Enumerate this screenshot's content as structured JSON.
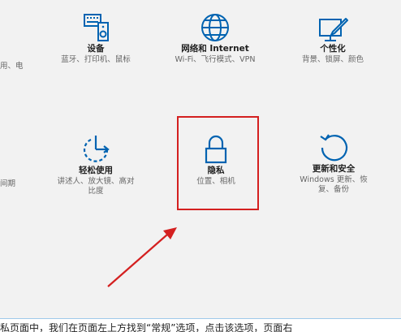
{
  "left_fragments": {
    "row1": "用、电",
    "row2": "间期"
  },
  "tiles": {
    "devices": {
      "icon": "devices-icon",
      "title": "设备",
      "desc": "蓝牙、打印机、鼠标"
    },
    "network": {
      "icon": "globe-icon",
      "title": "网络和 Internet",
      "desc": "Wi-Fi、飞行模式、VPN"
    },
    "personalization": {
      "icon": "personalization-icon",
      "title": "个性化",
      "desc": "背景、锁屏、颜色"
    },
    "ease_of_access": {
      "icon": "ease-of-access-icon",
      "title": "轻松使用",
      "desc_line1": "讲述人、放大镜、高对",
      "desc_line2": "比度"
    },
    "privacy": {
      "icon": "lock-icon",
      "title": "隐私",
      "desc": "位置、相机"
    },
    "update": {
      "icon": "refresh-icon",
      "title": "更新和安全",
      "desc_line1": "Windows 更新、恢",
      "desc_line2": "复、备份"
    }
  },
  "annotation": {
    "color": "#d42020"
  },
  "bottom_caption": "私页面中，我们在页面左上方找到“常规”选项，点击该选项，页面右"
}
